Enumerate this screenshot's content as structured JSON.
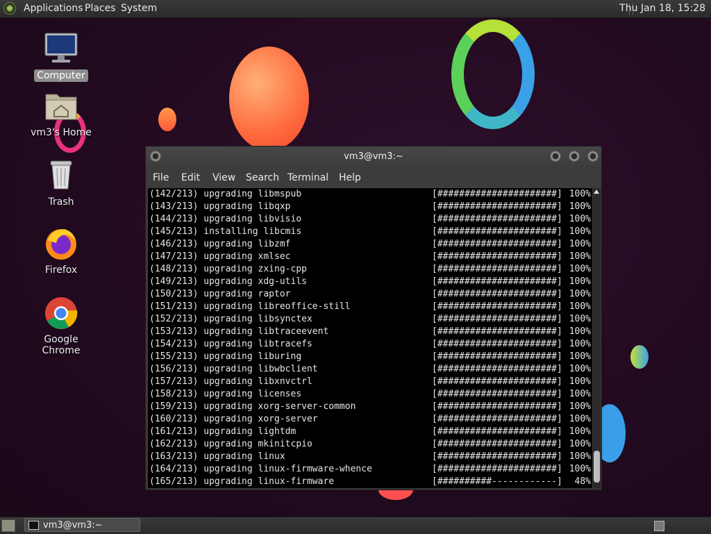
{
  "top_panel": {
    "menus": [
      "Applications",
      "Places",
      "System"
    ],
    "clock": "Thu Jan 18, 15:28"
  },
  "desktop_icons": [
    {
      "label": "Computer",
      "icon": "computer-icon"
    },
    {
      "label": "vm3's Home",
      "icon": "home-folder-icon"
    },
    {
      "label": "Trash",
      "icon": "trash-icon"
    },
    {
      "label": "Firefox",
      "icon": "firefox-icon"
    },
    {
      "label": "Google Chrome",
      "icon": "chrome-icon"
    }
  ],
  "terminal": {
    "title": "vm3@vm3:~",
    "menus": [
      "File",
      "Edit",
      "View",
      "Search",
      "Terminal",
      "Help"
    ],
    "lines": [
      {
        "text": "(142/213) upgrading libmspub",
        "bar": "[######################]",
        "pct": "100%"
      },
      {
        "text": "(143/213) upgrading libqxp",
        "bar": "[######################]",
        "pct": "100%"
      },
      {
        "text": "(144/213) upgrading libvisio",
        "bar": "[######################]",
        "pct": "100%"
      },
      {
        "text": "(145/213) installing libcmis",
        "bar": "[######################]",
        "pct": "100%"
      },
      {
        "text": "(146/213) upgrading libzmf",
        "bar": "[######################]",
        "pct": "100%"
      },
      {
        "text": "(147/213) upgrading xmlsec",
        "bar": "[######################]",
        "pct": "100%"
      },
      {
        "text": "(148/213) upgrading zxing-cpp",
        "bar": "[######################]",
        "pct": "100%"
      },
      {
        "text": "(149/213) upgrading xdg-utils",
        "bar": "[######################]",
        "pct": "100%"
      },
      {
        "text": "(150/213) upgrading raptor",
        "bar": "[######################]",
        "pct": "100%"
      },
      {
        "text": "(151/213) upgrading libreoffice-still",
        "bar": "[######################]",
        "pct": "100%"
      },
      {
        "text": "(152/213) upgrading libsynctex",
        "bar": "[######################]",
        "pct": "100%"
      },
      {
        "text": "(153/213) upgrading libtraceevent",
        "bar": "[######################]",
        "pct": "100%"
      },
      {
        "text": "(154/213) upgrading libtracefs",
        "bar": "[######################]",
        "pct": "100%"
      },
      {
        "text": "(155/213) upgrading liburing",
        "bar": "[######################]",
        "pct": "100%"
      },
      {
        "text": "(156/213) upgrading libwbclient",
        "bar": "[######################]",
        "pct": "100%"
      },
      {
        "text": "(157/213) upgrading libxnvctrl",
        "bar": "[######################]",
        "pct": "100%"
      },
      {
        "text": "(158/213) upgrading licenses",
        "bar": "[######################]",
        "pct": "100%"
      },
      {
        "text": "(159/213) upgrading xorg-server-common",
        "bar": "[######################]",
        "pct": "100%"
      },
      {
        "text": "(160/213) upgrading xorg-server",
        "bar": "[######################]",
        "pct": "100%"
      },
      {
        "text": "(161/213) upgrading lightdm",
        "bar": "[######################]",
        "pct": "100%"
      },
      {
        "text": "(162/213) upgrading mkinitcpio",
        "bar": "[######################]",
        "pct": "100%"
      },
      {
        "text": "(163/213) upgrading linux",
        "bar": "[######################]",
        "pct": "100%"
      },
      {
        "text": "(164/213) upgrading linux-firmware-whence",
        "bar": "[######################]",
        "pct": "100%"
      },
      {
        "text": "(165/213) upgrading linux-firmware",
        "bar": "[##########------------]",
        "pct": "48%"
      }
    ]
  },
  "bottom_panel": {
    "task_label": "vm3@vm3:~"
  }
}
